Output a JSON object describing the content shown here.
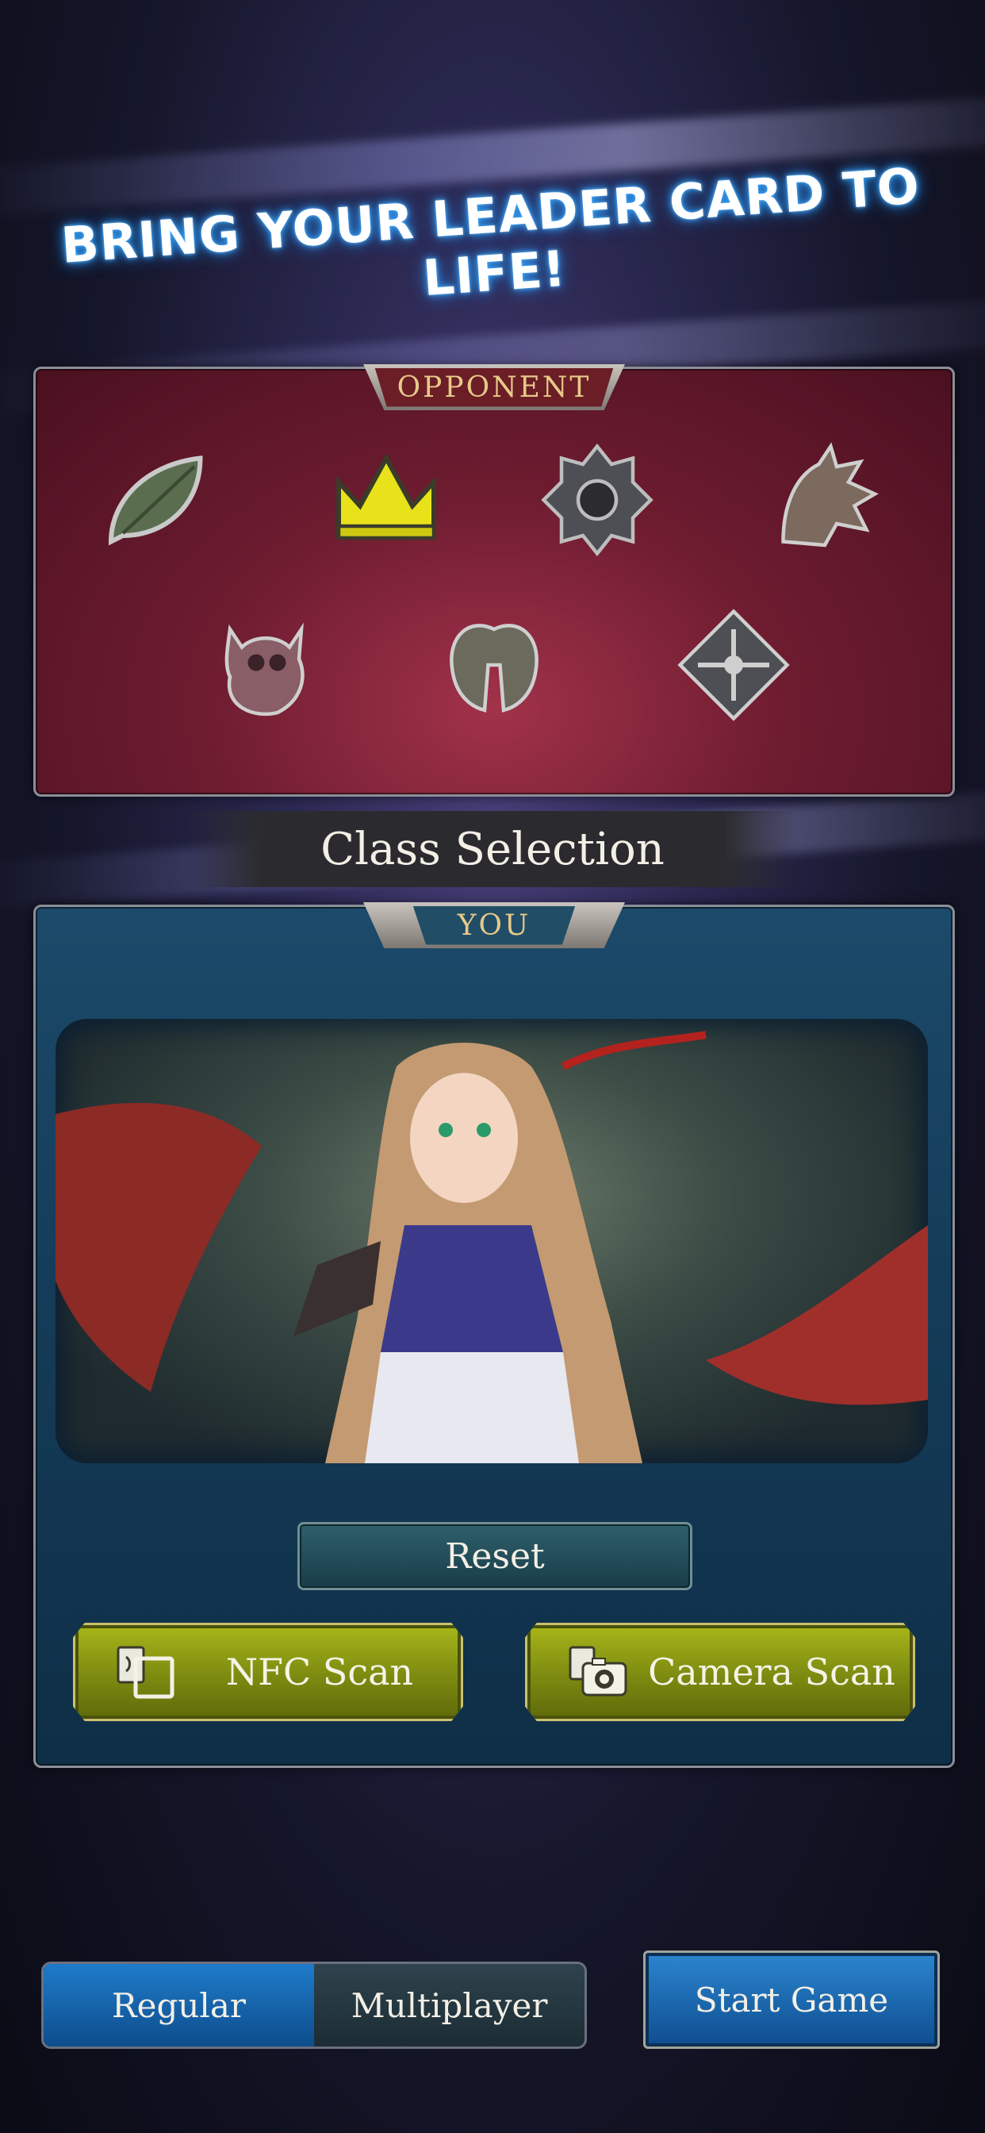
{
  "headline": "BRING YOUR LEADER CARD TO LIFE!",
  "opponent_panel": {
    "tab_label": "OPPONENT",
    "classes": [
      {
        "icon": "leaf-icon",
        "selected": false
      },
      {
        "icon": "crown-icon",
        "selected": true
      },
      {
        "icon": "star-seal-icon",
        "selected": false
      },
      {
        "icon": "dragon-icon",
        "selected": false
      },
      {
        "icon": "skull-ghost-icon",
        "selected": false
      },
      {
        "icon": "wings-icon",
        "selected": false
      },
      {
        "icon": "diamond-cross-icon",
        "selected": false
      }
    ]
  },
  "section_title": "Class Selection",
  "you_panel": {
    "tab_label": "YOU",
    "leader_art": "leader-card-art",
    "reset_label": "Reset",
    "nfc_label": "NFC Scan",
    "camera_label": "Camera Scan"
  },
  "mode": {
    "options": [
      "Regular",
      "Multiplayer"
    ],
    "selected": "Regular"
  },
  "start_label": "Start Game",
  "colors": {
    "headline_glow": "#3aa9ff",
    "opponent_bg": "#6e1c30",
    "you_bg": "#143c58",
    "scan_button": "#8d9a14",
    "primary_button": "#1f7bc9",
    "selected_class": "#e8e21b"
  }
}
